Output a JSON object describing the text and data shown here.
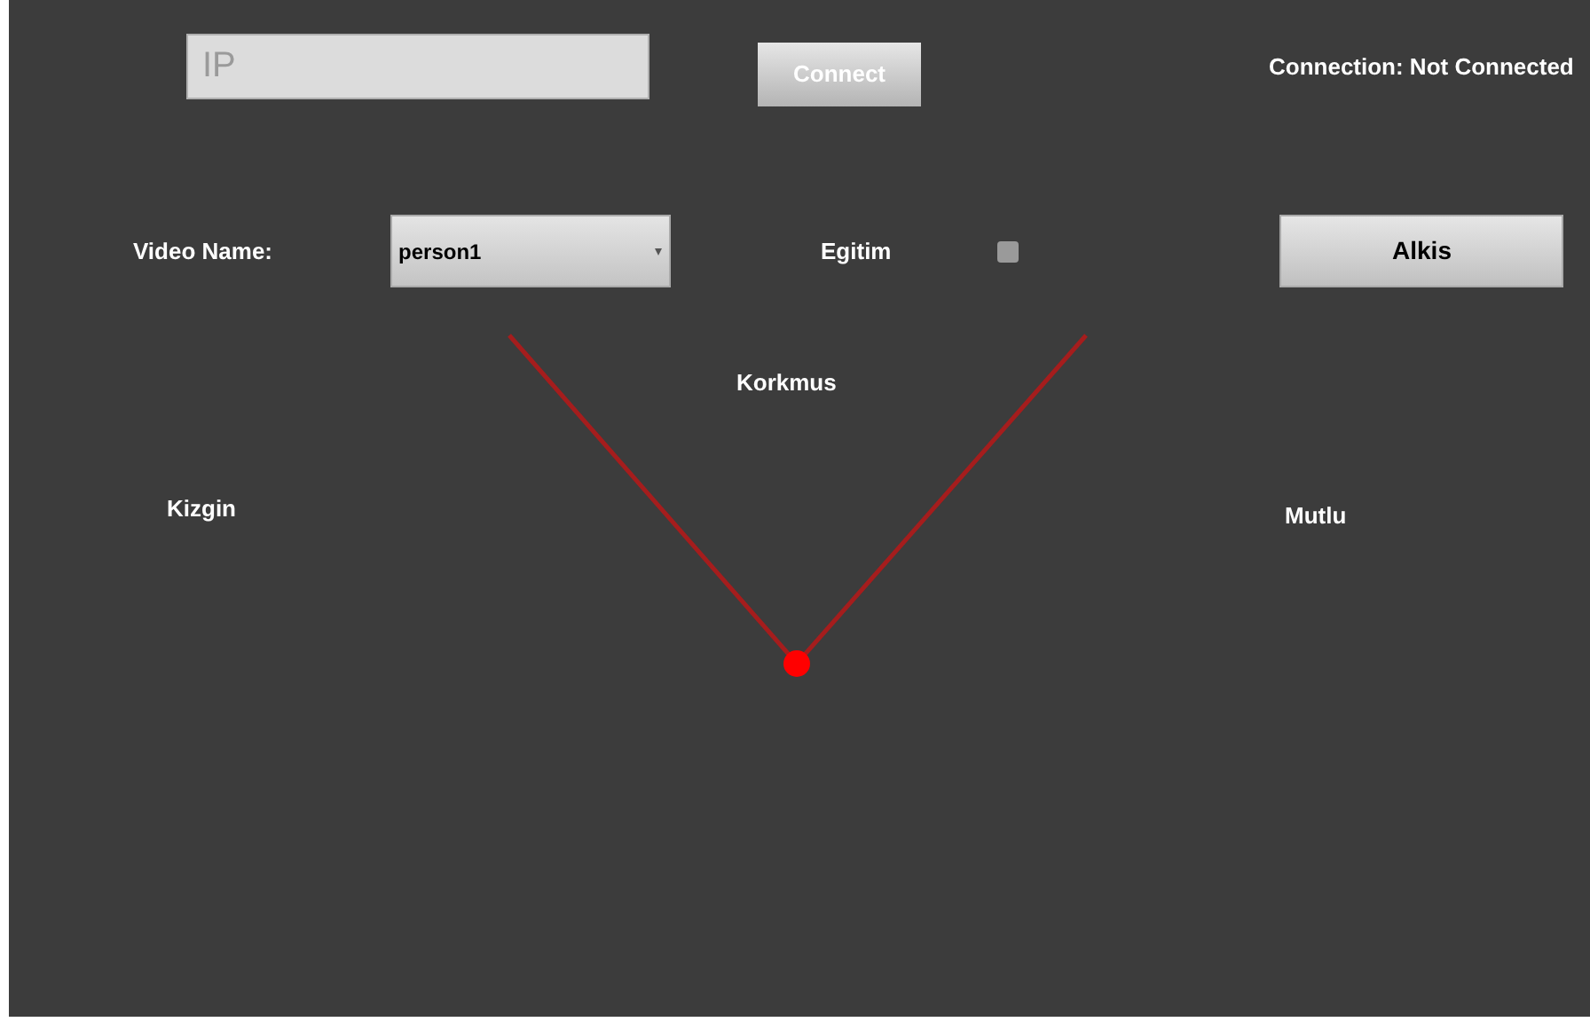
{
  "ip_field": {
    "placeholder": "IP"
  },
  "connect_button": {
    "label": "Connect"
  },
  "connection_status": "Connection: Not Connected",
  "video_name": {
    "label": "Video Name:",
    "value": "person1"
  },
  "training": {
    "label": "Egitim",
    "checked": false
  },
  "alkis_button": {
    "label": "Alkis"
  },
  "emotions": [
    {
      "label": "Korkmus",
      "kind": "top"
    },
    {
      "label": "Kizgin",
      "kind": "left"
    },
    {
      "label": "Mutlu",
      "kind": "right"
    }
  ]
}
